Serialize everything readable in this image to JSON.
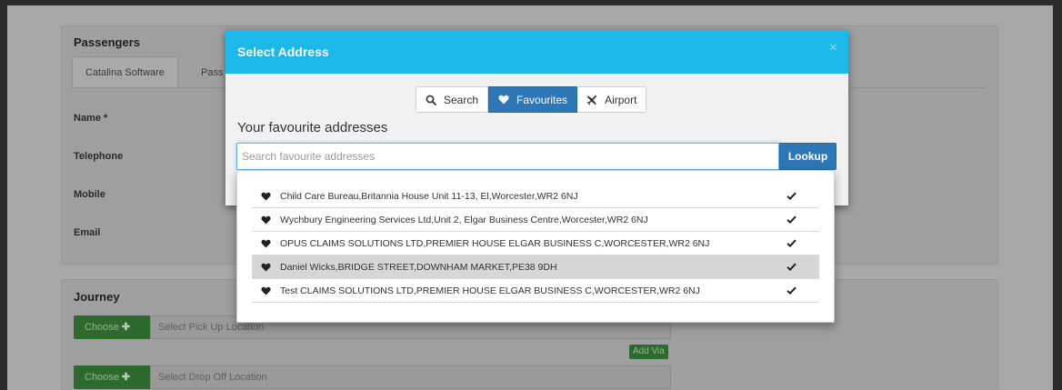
{
  "background": {
    "passengers": {
      "title": "Passengers",
      "tabs": [
        "Catalina Software",
        "Pass"
      ],
      "fields": [
        "Name *",
        "Telephone",
        "Mobile",
        "Email"
      ]
    },
    "journey": {
      "title": "Journey",
      "choose_label": "Choose",
      "pickup_placeholder": "Select Pick Up Location",
      "dropoff_placeholder": "Select Drop Off Location",
      "add_via_label": "Add Via"
    }
  },
  "modal": {
    "title": "Select Address",
    "close_glyph": "×",
    "tabs": [
      {
        "label": "Search",
        "icon": "search-icon",
        "active": false
      },
      {
        "label": "Favourites",
        "icon": "heart-icon",
        "active": true
      },
      {
        "label": "Airport",
        "icon": "plane-icon",
        "active": false
      }
    ],
    "heading": "Your favourite addresses",
    "search": {
      "placeholder": "Search favourite addresses",
      "value": "",
      "button_label": "Lookup"
    }
  },
  "favourites": [
    {
      "address": "Child Care Bureau,Britannia House Unit 11-13, El,Worcester,WR2 6NJ",
      "selected": true,
      "hover": false
    },
    {
      "address": "Wychbury Engineering Services Ltd,Unit 2, Elgar Business Centre,Worcester,WR2 6NJ",
      "selected": true,
      "hover": false
    },
    {
      "address": "OPUS CLAIMS SOLUTIONS LTD,PREMIER HOUSE ELGAR BUSINESS C,WORCESTER,WR2 6NJ",
      "selected": true,
      "hover": false
    },
    {
      "address": "Daniel Wicks,BRIDGE STREET,DOWNHAM MARKET,PE38 9DH",
      "selected": true,
      "hover": true
    },
    {
      "address": "Test CLAIMS SOLUTIONS LTD,PREMIER HOUSE ELGAR BUSINESS C,WORCESTER,WR2 6NJ",
      "selected": true,
      "hover": false
    }
  ],
  "colors": {
    "header": "#1cb8ea",
    "primary": "#2d77b7",
    "success": "#2e6a2e"
  }
}
